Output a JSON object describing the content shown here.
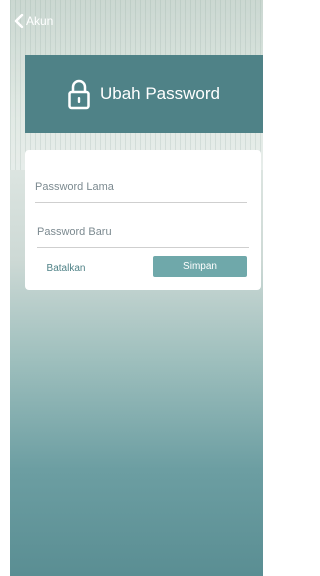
{
  "nav": {
    "back_label": "Akun"
  },
  "header": {
    "title": "Ubah Password",
    "icon": "lock-icon"
  },
  "form": {
    "old_password_placeholder": "Password Lama",
    "new_password_placeholder": "Password Baru",
    "cancel_label": "Batalkan",
    "save_label": "Simpan"
  },
  "colors": {
    "header_bg": "#4f8287",
    "save_button_bg": "#6fa8aa",
    "cancel_text": "#4f8287"
  }
}
